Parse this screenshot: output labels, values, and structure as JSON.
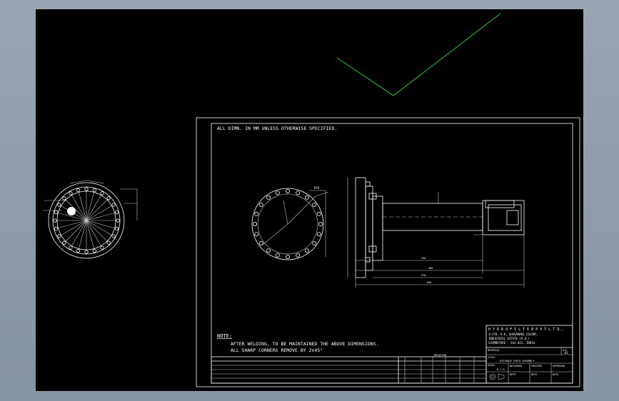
{
  "drawing": {
    "general_note": "ALL DIMN. IN MM UNLESS OTHERWISE SPECIFIED.",
    "note_heading": "NOTE:",
    "note_line_1": "AFTER WELDING, TO BE MAINTAINED THE ABOVE DIMENSIONS.",
    "note_line_2": "ALL SHARP CORNERS   REMOVE BY 2x45°"
  },
  "title_block": {
    "company": "H Y D R O   F I L T E R   P V T   L T D.,",
    "address_1": "3/170, A-8, SHASAMANI COLONY,",
    "address_2": "INDUSTRIAL ESTATE (P.O.)",
    "address_3": "COIMBATORE - 641 021,  INDIA.",
    "material_label": "MATERIAL",
    "qty_label": "QTY",
    "qty_value": "01",
    "title_label": "TITLE",
    "title_value": "DISTANCE PIECE ASSEMBLY",
    "scale_label": "SCALE",
    "scale_value": "N.T.S.",
    "designed_label": "DESIGNED",
    "checked_label": "CHECKED",
    "approved_label": "APPROVED",
    "date_label": "DATE",
    "revision_header": "REVISION"
  },
  "dimensions": {
    "pcd_label": "PCD",
    "d1": "250",
    "d2": "400",
    "d3": "570",
    "d4": "600"
  },
  "colors": {
    "background": "#000000",
    "window_frame": "#8a96a4",
    "linework": "#ffffff",
    "accent_line": "#22cc22"
  }
}
